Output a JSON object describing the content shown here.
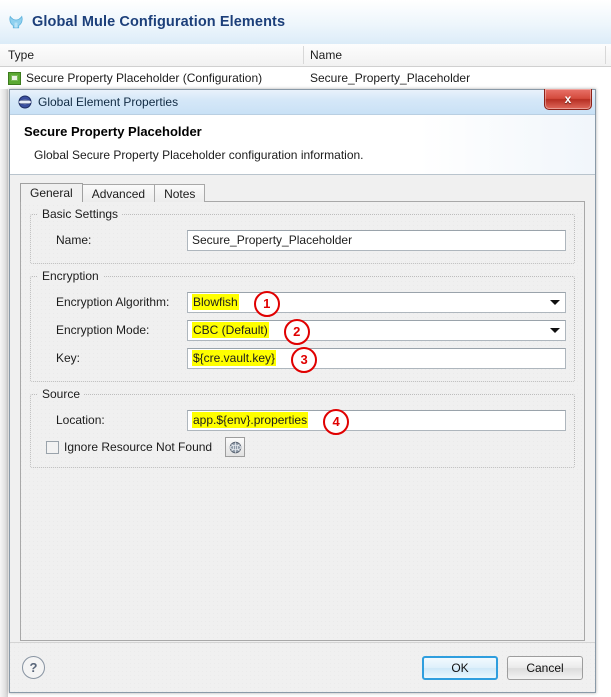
{
  "background_window": {
    "title": "Global Mule Configuration Elements",
    "icon": "mule-icon",
    "table": {
      "columns": [
        "Type",
        "Name",
        ""
      ],
      "rows": [
        {
          "icon": "configuration-element-icon",
          "type": "Secure Property Placeholder (Configuration)",
          "name": "Secure_Property_Placeholder",
          "extra": ""
        }
      ]
    }
  },
  "dialog": {
    "title": "Global Element Properties",
    "icon": "global-element-icon",
    "close_label": "x",
    "header": {
      "title": "Secure Property Placeholder",
      "subtitle": "Global Secure Property Placeholder configuration information."
    },
    "tabs": [
      {
        "label": "General",
        "active": true
      },
      {
        "label": "Advanced",
        "active": false
      },
      {
        "label": "Notes",
        "active": false
      }
    ],
    "groups": {
      "basic_settings": {
        "title": "Basic Settings",
        "fields": [
          {
            "label": "Name:",
            "value": "Secure_Property_Placeholder",
            "type": "text",
            "highlighted": false
          }
        ]
      },
      "encryption": {
        "title": "Encryption",
        "fields": [
          {
            "label": "Encryption Algorithm:",
            "value": "Blowfish",
            "type": "combo",
            "highlighted": true,
            "annotation": "1"
          },
          {
            "label": "Encryption Mode:",
            "value": "CBC (Default)",
            "type": "combo",
            "highlighted": true,
            "annotation": "2"
          },
          {
            "label": "Key:",
            "value": "${cre.vault.key}",
            "type": "text",
            "highlighted": true,
            "annotation": "3"
          }
        ]
      },
      "source": {
        "title": "Source",
        "fields": [
          {
            "label": "Location:",
            "value": "app.${env}.properties",
            "type": "text",
            "highlighted": true,
            "annotation": "4"
          }
        ],
        "checkbox": {
          "label": "Ignore Resource Not Found",
          "checked": false
        },
        "browse_button_icon": "globe-browse-icon"
      }
    },
    "footer": {
      "help_label": "?",
      "ok_label": "OK",
      "cancel_label": "Cancel"
    }
  },
  "colors": {
    "annotation": "#e00000",
    "highlight": "#ffff00",
    "title": "#1c3f7a",
    "primary_button_border": "#2f9ede"
  }
}
